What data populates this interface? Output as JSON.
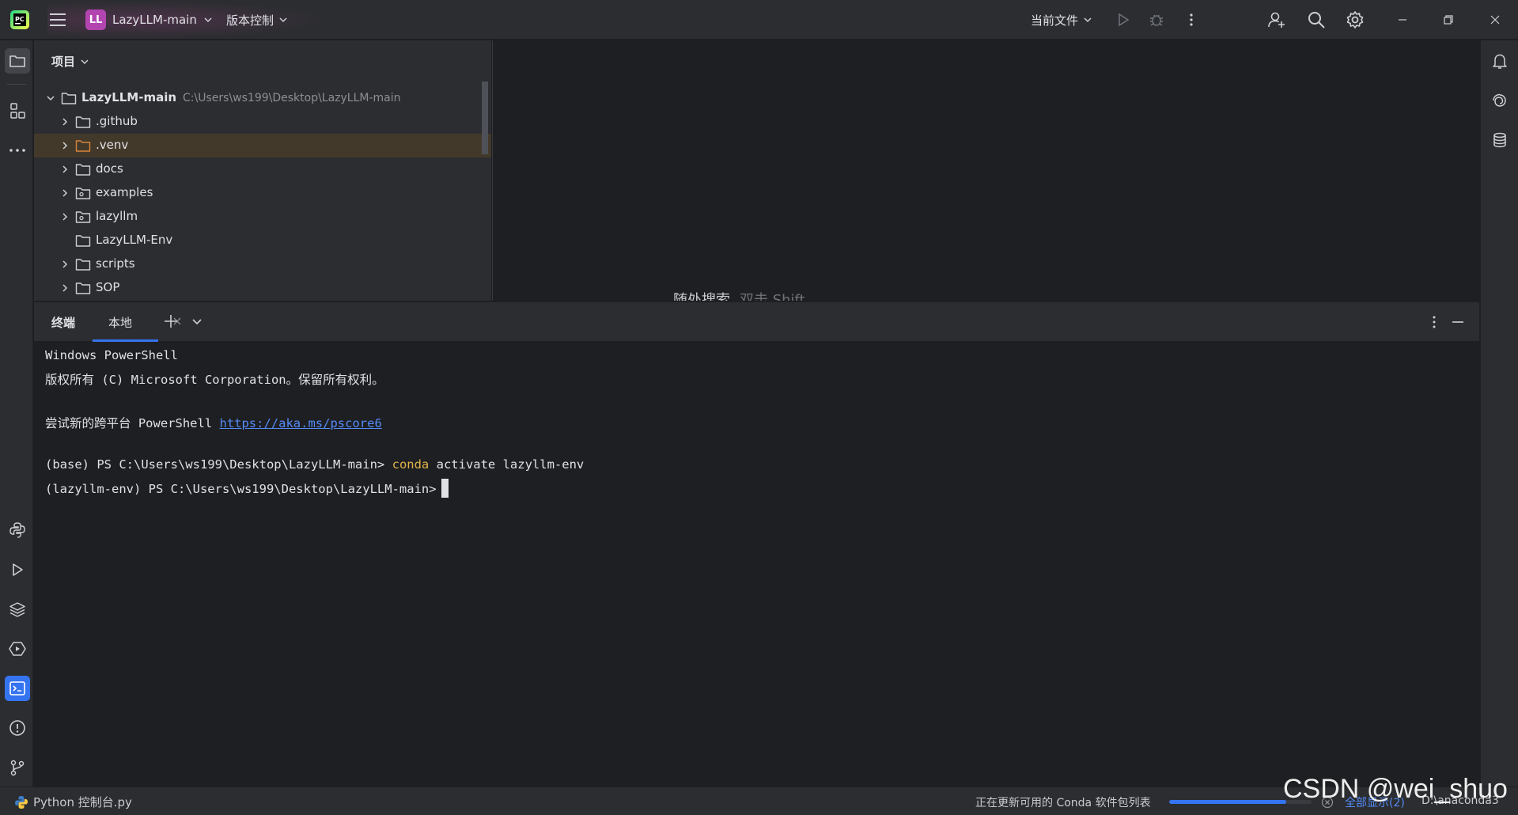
{
  "titlebar": {
    "project_avatar": "LL",
    "project_name": "LazyLLM-main",
    "vcs_label": "版本控制",
    "run_config": "当前文件"
  },
  "project_panel": {
    "title": "项目",
    "root": {
      "name": "LazyLLM-main",
      "path": "C:\\Users\\ws199\\Desktop\\LazyLLM-main"
    },
    "items": [
      {
        "name": ".github",
        "expandable": true
      },
      {
        "name": ".venv",
        "expandable": true,
        "selected": true
      },
      {
        "name": "docs",
        "expandable": true
      },
      {
        "name": "examples",
        "expandable": true
      },
      {
        "name": "lazyllm",
        "expandable": true
      },
      {
        "name": "LazyLLM-Env",
        "expandable": false
      },
      {
        "name": "scripts",
        "expandable": true
      },
      {
        "name": "SOP",
        "expandable": true
      }
    ]
  },
  "editor": {
    "hint": "随处搜索",
    "hint_shortcut": "双击 Shift"
  },
  "terminal": {
    "title": "终端",
    "tab_label": "本地",
    "lines": {
      "l1": "Windows PowerShell",
      "l2": "版权所有 (C) Microsoft Corporation。保留所有权利。",
      "l3_prefix": "尝试新的跨平台 PowerShell ",
      "l3_link": "https://aka.ms/pscore6",
      "l4_prompt": "(base) PS C:\\Users\\ws199\\Desktop\\LazyLLM-main> ",
      "l4_cmd": "conda",
      "l4_rest": " activate lazyllm-env",
      "l5_prompt": "(lazyllm-env) PS C:\\Users\\ws199\\Desktop\\LazyLLM-main>"
    }
  },
  "statusbar": {
    "file_label": "Python 控制台.py",
    "task_text": "正在更新可用的 Conda 软件包列表",
    "progress": 0.82,
    "show_all_link": "全部显示(2)",
    "interpreter": "D:\\anaconda3"
  },
  "watermark": "CSDN @wei_shuo",
  "colors": {
    "accent": "#3574f0",
    "avatar": "#b345b1",
    "command": "#e0b14a",
    "link": "#548af7",
    "selected_row": "#43392b",
    "venv_folder": "#d9853b"
  }
}
